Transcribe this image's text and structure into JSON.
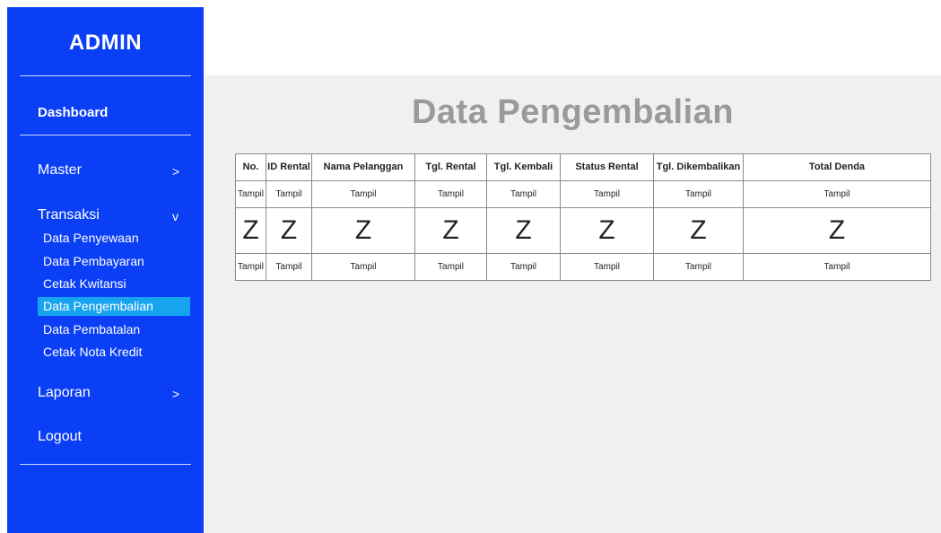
{
  "sidebar": {
    "brand": "ADMIN",
    "dashboard": "Dashboard",
    "master": {
      "label": "Master",
      "arrow": ">"
    },
    "transaksi": {
      "label": "Transaksi",
      "arrow": "v"
    },
    "sub_items": [
      "Data Penyewaan",
      "Data Pembayaran",
      "Cetak Kwitansi",
      "Data Pengembalian",
      "Data Pembatalan",
      "Cetak Nota Kredit"
    ],
    "active_item": "Data Pengembalian",
    "laporan": {
      "label": "Laporan",
      "arrow": ">"
    },
    "logout": "Logout"
  },
  "main": {
    "title": "Data Pengembalian",
    "table": {
      "headers": [
        "No.",
        "ID Rental",
        "Nama Pelanggan",
        "Tgl. Rental",
        "Tgl. Kembali",
        "Status Rental",
        "Tgl. Dikembalikan",
        "Total Denda"
      ],
      "rows": [
        [
          "Tampil",
          "Tampil",
          "Tampil",
          "Tampil",
          "Tampil",
          "Tampil",
          "Tampil",
          "Tampil"
        ],
        [
          "Z",
          "Z",
          "Z",
          "Z",
          "Z",
          "Z",
          "Z",
          "Z"
        ],
        [
          "Tampil",
          "Tampil",
          "Tampil",
          "Tampil",
          "Tampil",
          "Tampil",
          "Tampil",
          "Tampil"
        ]
      ]
    }
  },
  "colors": {
    "sidebar_bg": "#0a3ff5",
    "active_item_bg": "#17a4ef",
    "title_text": "#9a9a9a",
    "content_bg": "#f0f0f0"
  }
}
